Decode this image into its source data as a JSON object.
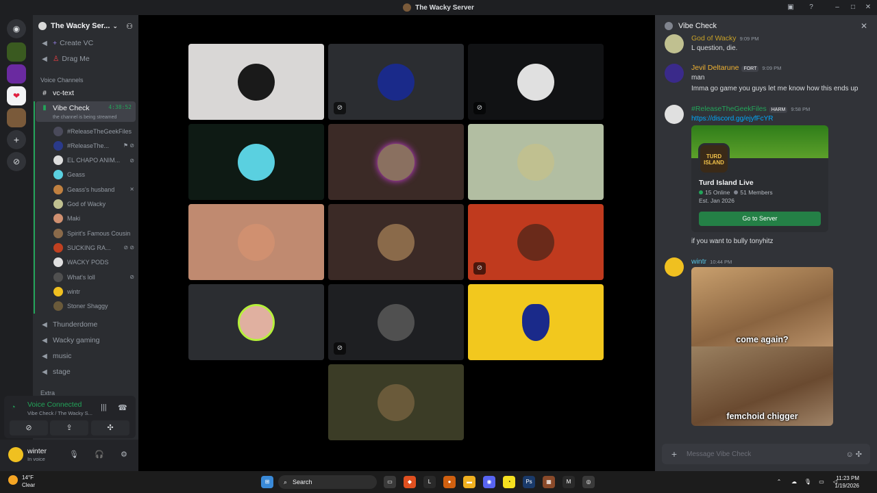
{
  "window": {
    "title": "The Wacky Server"
  },
  "server": {
    "name": "The Wacky Ser..."
  },
  "channels": {
    "create_vc": "Create VC",
    "drag_me": "Drag Me",
    "voice_category": "Voice Channels",
    "vc_text": "vc-text",
    "vibe_check": "Vibe Check",
    "vibe_timer": "4:38:52",
    "vibe_sub": "the channel is being streamed",
    "thunderdome": "Thunderdome",
    "wacky_gaming": "Wacky gaming",
    "music": "music",
    "stage": "stage",
    "extra_category": "Extra",
    "voice_users": [
      {
        "name": "#ReleaseTheGeekFiles",
        "color": "#4a4a5a"
      },
      {
        "name": "#ReleaseThe...",
        "color": "#2a3a8a"
      },
      {
        "name": "EL CHAPO ANIM...",
        "color": "#dddddd"
      },
      {
        "name": "Geass",
        "color": "#5ad0e0"
      },
      {
        "name": "Geass's husband",
        "color": "#c08040"
      },
      {
        "name": "God of Wacky",
        "color": "#c0c090"
      },
      {
        "name": "Maki",
        "color": "#d09070"
      },
      {
        "name": "Spirit's Famous Cousin",
        "color": "#8a6a4a"
      },
      {
        "name": "SUCKING RA...",
        "color": "#c04020"
      },
      {
        "name": "WACKY PODS",
        "color": "#e0e0e0"
      },
      {
        "name": "What's loll",
        "color": "#505050"
      },
      {
        "name": "wintr",
        "color": "#f0c020"
      },
      {
        "name": "Stoner Shaggy",
        "color": "#6a5a3a"
      }
    ]
  },
  "voice_panel": {
    "status": "Voice Connected",
    "location": "Vibe Check / The Wacky S..."
  },
  "user_panel": {
    "name": "winter",
    "status": "In voice"
  },
  "chat": {
    "title": "Vibe Check",
    "messages": [
      {
        "author": "God of Wacky",
        "time": "9:09 PM",
        "text": "L question, die.",
        "color": "#c9a227"
      },
      {
        "author": "Jevil Deltarune",
        "tag": "FORT",
        "time": "9:09 PM",
        "lines": [
          "man",
          "Imma go game you guys let me know how this ends up"
        ],
        "color": "#f0b232"
      },
      {
        "author": "#ReleaseTheGeekFiles",
        "tag": "HARM",
        "time": "9:58 PM",
        "link": "https://discord.gg/ejyfFcYR",
        "after": "if you want to bully tonyhitz",
        "color": "#23a55a"
      },
      {
        "author": "wintr",
        "time": "10:44 PM",
        "color": "#57c7e6"
      }
    ],
    "embed": {
      "icon_text": "TURD ISLAND",
      "name": "Turd Island Live",
      "online": "15 Online",
      "members": "51 Members",
      "est": "Est. Jan 2026",
      "button": "Go to Server"
    },
    "meme": {
      "top_caption": "come again?",
      "bottom_caption": "femchoid chigger"
    },
    "input_placeholder": "Message Vibe Check"
  },
  "taskbar": {
    "temp": "14°F",
    "condition": "Clear",
    "search": "Search",
    "time": "11:23 PM",
    "date": "1/19/2026"
  }
}
